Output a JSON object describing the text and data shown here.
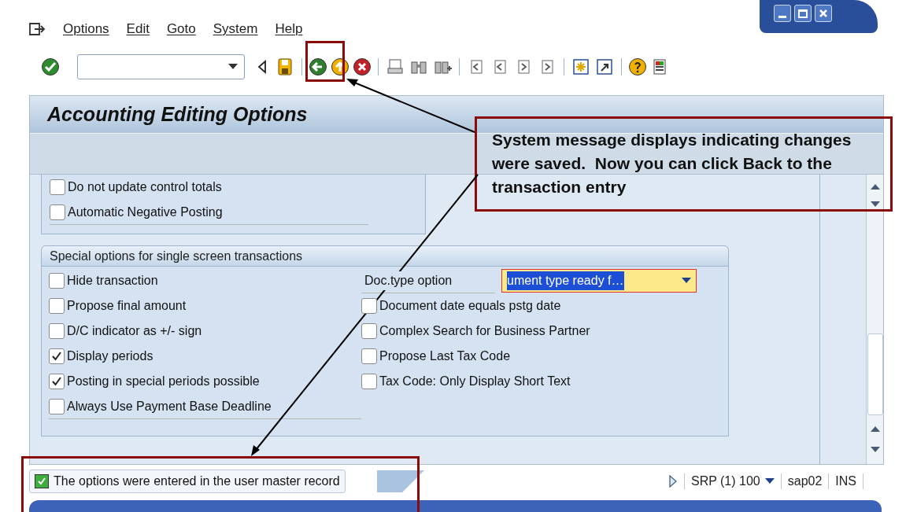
{
  "menu": {
    "items": [
      "Options",
      "Edit",
      "Goto",
      "System",
      "Help"
    ]
  },
  "screen": {
    "title": "Accounting Editing Options"
  },
  "sections": [
    {
      "options": [
        {
          "label": "Do not update control totals",
          "checked": false
        },
        {
          "label": "Automatic Negative Posting",
          "checked": false
        }
      ]
    },
    {
      "title": "Special options for single screen transactions",
      "left_options": [
        {
          "label": "Hide transaction",
          "checked": false
        },
        {
          "label": "Propose final amount",
          "checked": false
        },
        {
          "label": "D/C indicator as +/- sign",
          "checked": false
        },
        {
          "label": "Display periods",
          "checked": true
        },
        {
          "label": "Posting in special periods possible",
          "checked": true
        },
        {
          "label": "Always Use Payment Base Deadline",
          "checked": false
        }
      ],
      "doc_type": {
        "label": "Doc.type option",
        "value": "ument type ready f…",
        "selected": true
      },
      "right_options": [
        {
          "label": "Document date equals pstg date",
          "checked": false
        },
        {
          "label": "Complex Search for Business Partner",
          "checked": false
        },
        {
          "label": "Propose Last Tax Code",
          "checked": false
        },
        {
          "label": "Tax Code: Only Display Short Text",
          "checked": false
        }
      ]
    }
  ],
  "status_bar": {
    "message": "The options were entered in the user master record",
    "system": "SRP (1) 100",
    "server": "sap02",
    "mode": "INS"
  },
  "annotation": {
    "text": "System message displays indicating changes were saved.  Now you can click Back to the transaction entry"
  }
}
